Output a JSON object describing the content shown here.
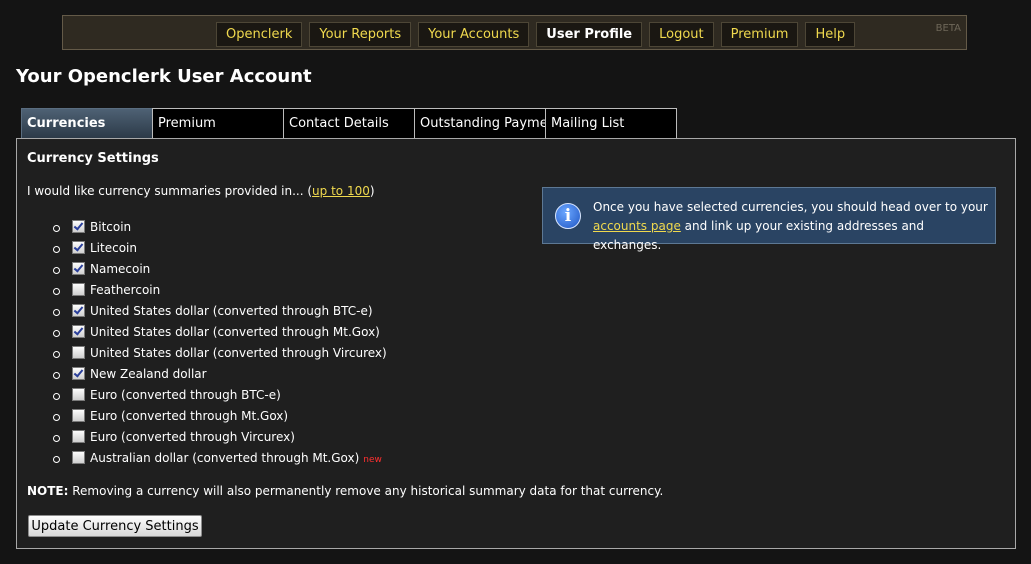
{
  "nav": {
    "items": [
      {
        "label": "Openclerk",
        "active": false
      },
      {
        "label": "Your Reports",
        "active": false
      },
      {
        "label": "Your Accounts",
        "active": false
      },
      {
        "label": "User Profile",
        "active": true
      },
      {
        "label": "Logout",
        "active": false
      },
      {
        "label": "Premium",
        "active": false
      },
      {
        "label": "Help",
        "active": false
      }
    ],
    "beta": "BETA"
  },
  "page": {
    "title": "Your Openclerk User Account"
  },
  "tabs": [
    {
      "label": "Currencies",
      "active": true
    },
    {
      "label": "Premium",
      "active": false
    },
    {
      "label": "Contact Details",
      "active": false
    },
    {
      "label": "Outstanding Payments",
      "active": false
    },
    {
      "label": "Mailing List",
      "active": false
    }
  ],
  "settings": {
    "heading": "Currency Settings",
    "intro_prefix": "I would like currency summaries provided in... (",
    "intro_link": "up to 100",
    "intro_suffix": ")",
    "currencies": [
      {
        "label": "Bitcoin",
        "checked": true,
        "new": false
      },
      {
        "label": "Litecoin",
        "checked": true,
        "new": false
      },
      {
        "label": "Namecoin",
        "checked": true,
        "new": false
      },
      {
        "label": "Feathercoin",
        "checked": false,
        "new": false
      },
      {
        "label": "United States dollar (converted through BTC-e)",
        "checked": true,
        "new": false
      },
      {
        "label": "United States dollar (converted through Mt.Gox)",
        "checked": true,
        "new": false
      },
      {
        "label": "United States dollar (converted through Vircurex)",
        "checked": false,
        "new": false
      },
      {
        "label": "New Zealand dollar",
        "checked": true,
        "new": false
      },
      {
        "label": "Euro (converted through BTC-e)",
        "checked": false,
        "new": false
      },
      {
        "label": "Euro (converted through Mt.Gox)",
        "checked": false,
        "new": false
      },
      {
        "label": "Euro (converted through Vircurex)",
        "checked": false,
        "new": false
      },
      {
        "label": "Australian dollar (converted through Mt.Gox)",
        "checked": false,
        "new": true
      }
    ],
    "new_badge": "new",
    "note_label": "NOTE:",
    "note_text": " Removing a currency will also permanently remove any historical summary data for that currency.",
    "update_button": "Update Currency Settings"
  },
  "info": {
    "icon": "info-icon",
    "text_prefix": "Once you have selected currencies, you should head over to your ",
    "link": "accounts page",
    "text_suffix": " and link up your existing addresses and exchanges."
  },
  "colors": {
    "accent_link": "#f0d94e",
    "tab_active": "#3a4a5a",
    "info_bg": "#2a4463",
    "new_badge": "#ff3030"
  }
}
